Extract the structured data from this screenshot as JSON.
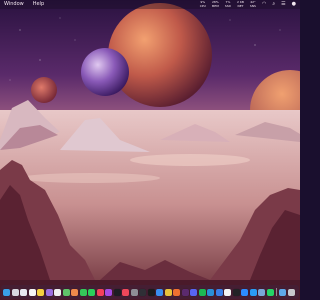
{
  "menubar": {
    "items": [
      {
        "label": "Window"
      },
      {
        "label": "Help"
      }
    ],
    "stats": [
      {
        "value": "9%",
        "label": "CPU"
      },
      {
        "value": "28%",
        "label": "MEM"
      },
      {
        "value": "7%",
        "label": "SSD"
      },
      {
        "value": "2 KB",
        "label": "NET"
      },
      {
        "value": "42°",
        "label": "SNS"
      }
    ],
    "icons": [
      {
        "name": "wifi-icon",
        "glyph": "◠"
      },
      {
        "name": "search-icon",
        "glyph": "⌕"
      },
      {
        "name": "control-center-icon",
        "glyph": "☰"
      },
      {
        "name": "siri-icon",
        "glyph": "●"
      }
    ]
  },
  "dock": {
    "apps": [
      {
        "name": "finder",
        "color": "#3aa0e8"
      },
      {
        "name": "launchpad",
        "color": "#d8d8e0"
      },
      {
        "name": "mail",
        "color": "#e8e8f0"
      },
      {
        "name": "calendar",
        "color": "#f6f6f6"
      },
      {
        "name": "notes",
        "color": "#f4d03f"
      },
      {
        "name": "files",
        "color": "#9c6fe0"
      },
      {
        "name": "reminders",
        "color": "#f0f0f0"
      },
      {
        "name": "maps",
        "color": "#5fc46a"
      },
      {
        "name": "photos",
        "color": "#f08a4b"
      },
      {
        "name": "facetime",
        "color": "#35c759"
      },
      {
        "name": "messages",
        "color": "#2ad05b"
      },
      {
        "name": "music",
        "color": "#f5405a"
      },
      {
        "name": "podcasts",
        "color": "#a44be3"
      },
      {
        "name": "tv",
        "color": "#1d1d22"
      },
      {
        "name": "news",
        "color": "#f0475a"
      },
      {
        "name": "system-settings",
        "color": "#8e8e96"
      },
      {
        "name": "activity-monitor",
        "color": "#2f2f36"
      },
      {
        "name": "terminal",
        "color": "#1c1c1c"
      },
      {
        "name": "safari",
        "color": "#3a8ef0"
      },
      {
        "name": "chrome",
        "color": "#e8c23a"
      },
      {
        "name": "firefox",
        "color": "#f07030"
      },
      {
        "name": "slack",
        "color": "#5b2a6e"
      },
      {
        "name": "discord",
        "color": "#5865f2"
      },
      {
        "name": "spotify",
        "color": "#1db954"
      },
      {
        "name": "vscode",
        "color": "#2a8fd8"
      },
      {
        "name": "xcode",
        "color": "#3a7ee8"
      },
      {
        "name": "notion",
        "color": "#f4f4f4"
      },
      {
        "name": "figma",
        "color": "#222226"
      },
      {
        "name": "zoom",
        "color": "#2d8cff"
      },
      {
        "name": "app-store",
        "color": "#2a9cf5"
      },
      {
        "name": "preview",
        "color": "#7aa6d8"
      },
      {
        "name": "whatsapp",
        "color": "#25d366"
      }
    ],
    "trailing": [
      {
        "name": "downloads",
        "color": "#5fa8e8"
      },
      {
        "name": "trash",
        "color": "#c8c8cc"
      }
    ]
  }
}
